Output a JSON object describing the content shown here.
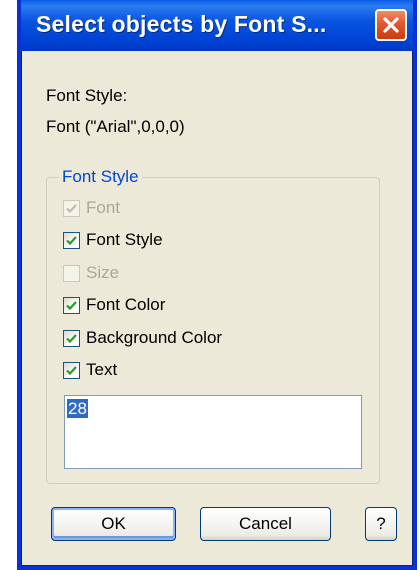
{
  "window": {
    "title": "Select objects by Font S...",
    "close_icon": "close-icon"
  },
  "info": {
    "font_style_label": "Font Style:",
    "font_value": "Font (\"Arial\",0,0,0)"
  },
  "group": {
    "legend": "Font Style",
    "checkboxes": [
      {
        "label": "Font",
        "checked": true,
        "enabled": false
      },
      {
        "label": "Font Style",
        "checked": true,
        "enabled": true
      },
      {
        "label": "Size",
        "checked": false,
        "enabled": false
      },
      {
        "label": "Font Color",
        "checked": true,
        "enabled": true
      },
      {
        "label": "Background Color",
        "checked": true,
        "enabled": true
      },
      {
        "label": "Text",
        "checked": true,
        "enabled": true
      }
    ],
    "text_value": "28"
  },
  "buttons": {
    "ok": "OK",
    "cancel": "Cancel",
    "help": "?"
  },
  "colors": {
    "title_bar": "#0a55e0",
    "close_button": "#e2572e",
    "group_legend": "#0046d5",
    "check_mark": "#21a121",
    "selection": "#316ac5"
  }
}
